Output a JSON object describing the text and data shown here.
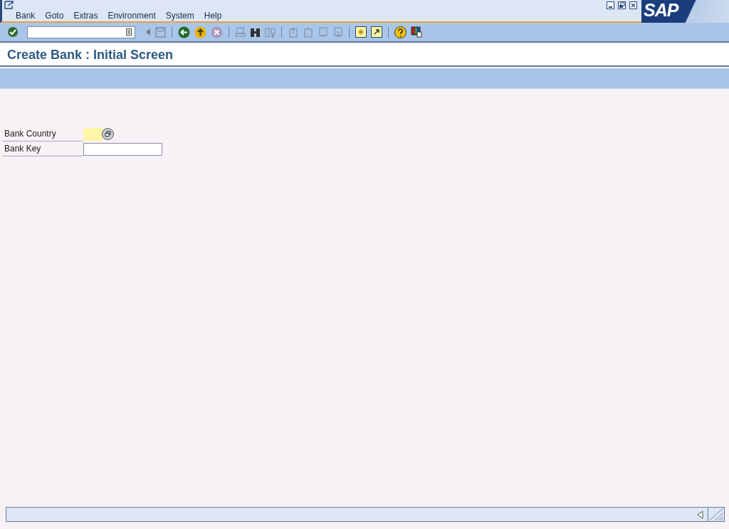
{
  "menu": [
    "Bank",
    "Goto",
    "Extras",
    "Environment",
    "System",
    "Help"
  ],
  "logo": "SAP",
  "title": "Create Bank : Initial Screen",
  "fields": [
    {
      "label": "Bank Country",
      "required": true,
      "kind": "short",
      "help": true
    },
    {
      "label": "Bank Key",
      "required": false,
      "kind": "long",
      "help": false
    }
  ]
}
